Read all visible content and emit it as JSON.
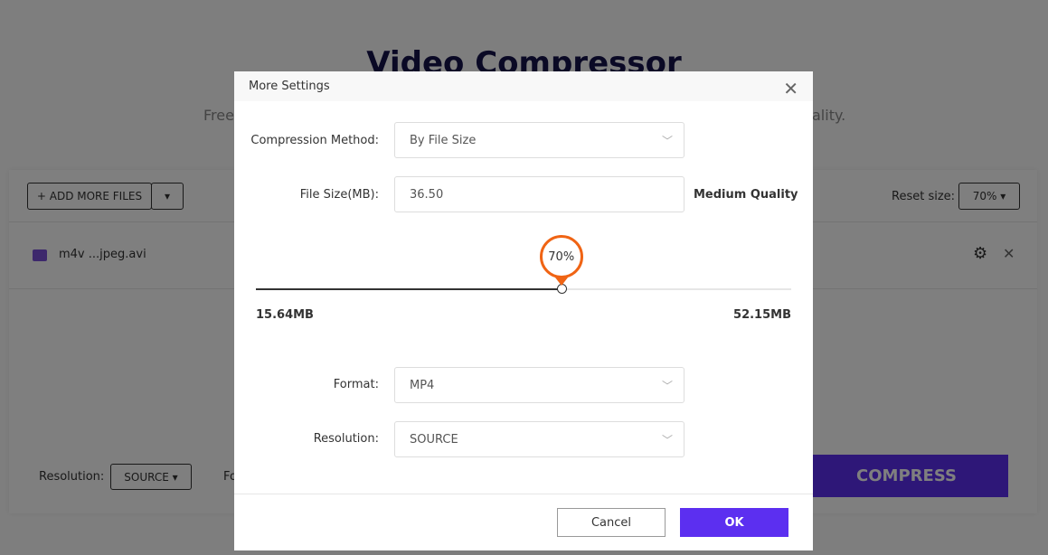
{
  "page": {
    "title": "Video Compressor",
    "subtitle_left": "Free",
    "subtitle_right": "ality.",
    "add_files": "+ ADD MORE FILES",
    "reset_label": "Reset size:",
    "reset_value": "70%",
    "file_name": "m4v ...jpeg.avi",
    "resolution_label": "Resolution:",
    "resolution_value": "SOURCE",
    "format_label_partial": "Fo",
    "compress": "COMPRESS"
  },
  "modal": {
    "title": "More Settings",
    "compression_method_label": "Compression Method:",
    "compression_method_value": "By File Size",
    "file_size_label": "File Size(MB):",
    "file_size_value": "36.50",
    "quality_label": "Medium Quality",
    "slider": {
      "percent": 70,
      "percent_label": "70%",
      "min_label": "15.64MB",
      "max_label": "52.15MB"
    },
    "format_label": "Format:",
    "format_value": "MP4",
    "resolution_label": "Resolution:",
    "resolution_value": "SOURCE",
    "cancel": "Cancel",
    "ok": "OK"
  },
  "colors": {
    "accent": "#5c2ff0",
    "slider_bubble": "#f06414"
  }
}
